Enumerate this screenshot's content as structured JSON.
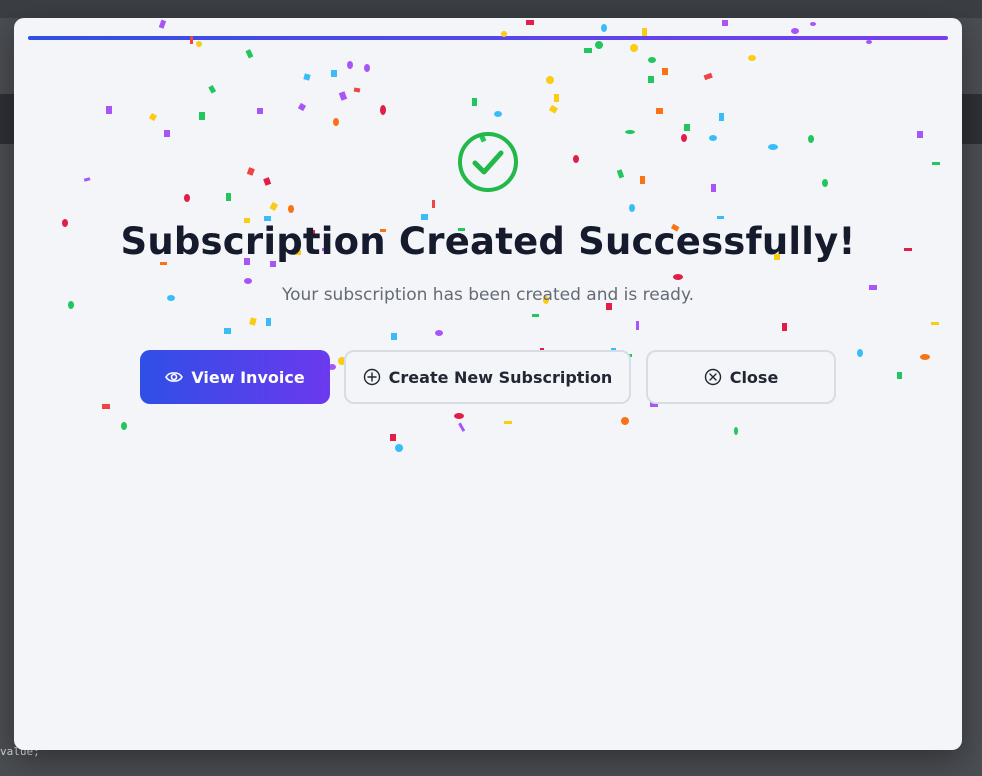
{
  "dialog": {
    "title": "Subscription Created Successfully!",
    "subtitle": "Your subscription has been created and is ready.",
    "icon": "check-circle-icon",
    "accent_color": "#22b84a",
    "buttons": {
      "view_invoice": {
        "label": "View Invoice",
        "icon": "eye-icon"
      },
      "create_new": {
        "label": "Create New Subscription",
        "icon": "plus-circle-icon"
      },
      "close": {
        "label": "Close",
        "icon": "close-circle-icon"
      }
    }
  },
  "background": {
    "code_line": "value;"
  },
  "colors": {
    "primary_gradient_start": "#2f4fe6",
    "primary_gradient_end": "#6b39ee",
    "confetti": [
      "#a855f7",
      "#22c55e",
      "#ef4444",
      "#3b82f6",
      "#facc15",
      "#38bdf8",
      "#f97316",
      "#e11d48"
    ]
  }
}
